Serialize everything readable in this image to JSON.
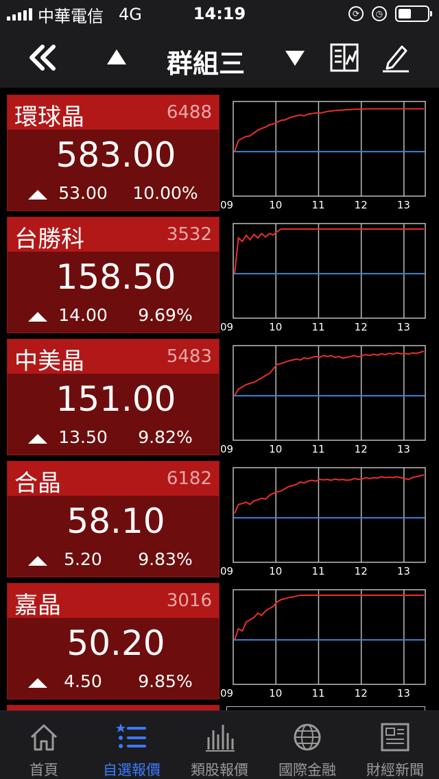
{
  "status_bar": {
    "carrier": "中華電信",
    "network": "4G",
    "time": "14:19"
  },
  "header": {
    "title": "群組三"
  },
  "stocks": [
    {
      "name": "環球晶",
      "code": "6488",
      "price": "583.00",
      "change": "53.00",
      "percent": "10.00%",
      "chart": {
        "series": [
          0.0,
          0.25,
          0.3,
          0.34,
          0.35,
          0.42,
          0.48,
          0.52,
          0.55,
          0.6,
          0.62,
          0.66,
          0.7,
          0.71,
          0.75,
          0.78,
          0.8,
          0.82,
          0.8,
          0.84,
          0.85,
          0.87,
          0.86,
          0.88,
          0.9,
          0.91,
          0.92,
          0.93,
          0.93,
          0.94,
          0.94,
          0.95,
          0.95,
          0.95,
          0.96,
          0.96,
          0.96,
          0.96,
          0.96,
          0.96,
          0.96,
          0.96,
          0.96,
          0.96,
          0.96,
          0.96,
          0.96,
          0.96,
          0.96,
          0.96
        ],
        "reference_level": 0.0
      }
    },
    {
      "name": "台勝科",
      "code": "3532",
      "price": "158.50",
      "change": "14.00",
      "percent": "9.69%",
      "chart": {
        "series": [
          0.0,
          0.8,
          0.72,
          0.86,
          0.76,
          0.88,
          0.8,
          0.9,
          0.82,
          0.9,
          0.87,
          0.94,
          1.0,
          1.0,
          1.0,
          1.0,
          1.0,
          1.0,
          1.0,
          1.0,
          1.0,
          1.0,
          1.0,
          1.0,
          1.0,
          1.0,
          1.0,
          1.0,
          1.0,
          1.0,
          1.0,
          1.0,
          1.0,
          1.0,
          1.0,
          1.0,
          1.0,
          1.0,
          1.0,
          1.0,
          1.0,
          1.0,
          1.0,
          1.0,
          1.0,
          1.0,
          1.0,
          1.0,
          1.0,
          1.0
        ],
        "reference_level": 0.0
      }
    },
    {
      "name": "中美晶",
      "code": "5483",
      "price": "151.00",
      "change": "13.50",
      "percent": "9.82%",
      "chart": {
        "series": [
          0.0,
          0.15,
          0.2,
          0.25,
          0.28,
          0.3,
          0.35,
          0.4,
          0.45,
          0.5,
          0.6,
          0.7,
          0.72,
          0.75,
          0.78,
          0.8,
          0.82,
          0.8,
          0.85,
          0.83,
          0.86,
          0.88,
          0.86,
          0.9,
          0.88,
          0.9,
          0.86,
          0.88,
          0.84,
          0.86,
          0.88,
          0.9,
          0.87,
          0.9,
          0.92,
          0.9,
          0.93,
          0.91,
          0.94,
          0.92,
          0.95,
          0.93,
          0.96,
          0.94,
          0.95,
          0.93,
          0.96,
          0.95,
          0.97,
          1.0
        ],
        "reference_level": 0.0
      }
    },
    {
      "name": "合晶",
      "code": "6182",
      "price": "58.10",
      "change": "5.20",
      "percent": "9.83%",
      "chart": {
        "series": [
          0.1,
          0.3,
          0.32,
          0.35,
          0.3,
          0.38,
          0.4,
          0.44,
          0.42,
          0.5,
          0.55,
          0.58,
          0.6,
          0.65,
          0.7,
          0.72,
          0.75,
          0.8,
          0.78,
          0.82,
          0.84,
          0.82,
          0.86,
          0.85,
          0.86,
          0.84,
          0.87,
          0.85,
          0.86,
          0.84,
          0.85,
          0.88,
          0.86,
          0.87,
          0.9,
          0.88,
          0.9,
          0.89,
          0.92,
          0.9,
          0.91,
          0.9,
          0.92,
          0.9,
          0.88,
          0.86,
          0.9,
          0.92,
          0.94,
          0.96
        ],
        "reference_level": 0.0
      }
    },
    {
      "name": "嘉晶",
      "code": "3016",
      "price": "50.20",
      "change": "4.50",
      "percent": "9.85%",
      "chart": {
        "series": [
          0.0,
          0.25,
          0.2,
          0.4,
          0.45,
          0.5,
          0.6,
          0.55,
          0.65,
          0.7,
          0.75,
          0.85,
          0.9,
          0.92,
          0.95,
          0.96,
          0.98,
          1.0,
          1.0,
          1.0,
          1.0,
          1.0,
          1.0,
          1.0,
          1.0,
          1.0,
          1.0,
          1.0,
          1.0,
          1.0,
          1.0,
          1.0,
          1.0,
          1.0,
          1.0,
          1.0,
          1.0,
          1.0,
          1.0,
          1.0,
          1.0,
          1.0,
          1.0,
          1.0,
          1.0,
          1.0,
          1.0,
          1.0,
          1.0,
          1.0
        ],
        "reference_level": 0.0
      }
    }
  ],
  "chart_axis": {
    "x_ticks": [
      "09",
      "10",
      "11",
      "12",
      "13"
    ]
  },
  "tab_bar": {
    "tabs": [
      {
        "label": "首頁",
        "icon": "home-icon",
        "active": false
      },
      {
        "label": "自選報價",
        "icon": "watchlist-icon",
        "active": true
      },
      {
        "label": "類股報價",
        "icon": "bar-chart-icon",
        "active": false
      },
      {
        "label": "國際金融",
        "icon": "globe-icon",
        "active": false
      },
      {
        "label": "財經新聞",
        "icon": "newspaper-icon",
        "active": false
      }
    ]
  },
  "colors": {
    "price_line": "#e8302a",
    "reference_line": "#3a84d6",
    "card_head": "#b21818",
    "card_body": "#6e0d0d",
    "active_tab": "#3b7bff"
  }
}
